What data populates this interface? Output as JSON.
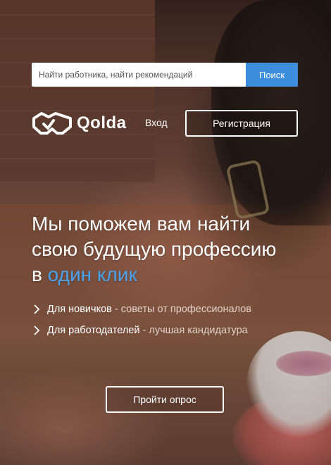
{
  "search": {
    "placeholder": "Найти работника, найти рекомендаций",
    "button_label": "Поиск"
  },
  "header": {
    "logo_text": "Qolda",
    "login_label": "Вход",
    "register_label": "Регистрация"
  },
  "hero": {
    "headline_line1": "Мы поможем вам найти",
    "headline_line2": "свою будущую профессию",
    "headline_prefix": "в",
    "headline_accent": "один клик",
    "bullets": [
      {
        "title": "Для новичков",
        "separator": " - ",
        "desc": "советы от профессионалов"
      },
      {
        "title": "Для работодателей",
        "separator": " - ",
        "desc": "лучшая кандидатура"
      }
    ],
    "survey_button_label": "Пройти опрос"
  },
  "colors": {
    "accent": "#3e8fdb",
    "accent_text": "#4aa3ee",
    "text": "#ffffff"
  },
  "icons": {
    "logo": "handshake-icon",
    "bullet": "chevron-right-icon"
  }
}
